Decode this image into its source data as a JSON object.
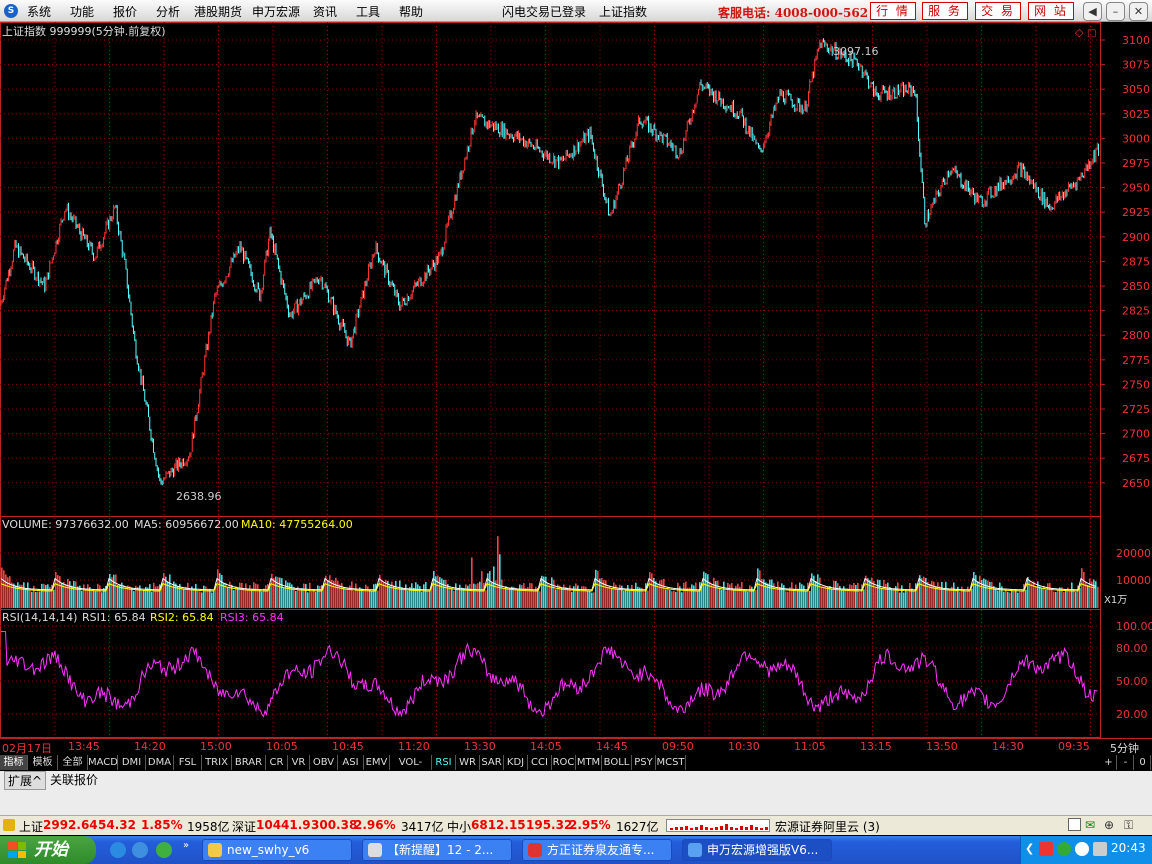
{
  "menu": {
    "items": [
      "系统",
      "功能",
      "报价",
      "分析",
      "港股期货",
      "申万宏源",
      "资讯",
      "工具",
      "帮助"
    ],
    "center": [
      "闪电交易已登录",
      "上证指数"
    ],
    "hotline": "客服电话: 4008-000-562",
    "buttons": [
      "行 情",
      "服 务",
      "交 易",
      "网 站"
    ]
  },
  "chart": {
    "title": "上证指数 999999(5分钟.前复权)",
    "high_label": "3097.16",
    "low_label": "2638.96",
    "price_ticks": [
      "3100",
      "3075",
      "3050",
      "3025",
      "3000",
      "2975",
      "2950",
      "2925",
      "2900",
      "2875",
      "2850",
      "2825",
      "2800",
      "2775",
      "2750",
      "2725",
      "2700",
      "2675",
      "2650"
    ],
    "volume": {
      "label": "VOLUME: 97376632.00",
      "ma5": "MA5: 60956672.00",
      "ma10": "MA10: 47755264.00",
      "ticks": [
        "20000",
        "10000"
      ],
      "unit": "X1万"
    },
    "rsi": {
      "label": "RSI(14,14,14)",
      "rsi1": "RSI1: 65.84",
      "rsi2": "RSI2: 65.84",
      "rsi3": "RSI3: 65.84",
      "ticks": [
        "100.00",
        "80.00",
        "50.00",
        "20.00"
      ]
    },
    "time_labels": [
      "02月17日",
      "13:45",
      "14:20",
      "15:00",
      "10:05",
      "10:45",
      "11:20",
      "13:30",
      "14:05",
      "14:45",
      "09:50",
      "10:30",
      "11:05",
      "13:15",
      "13:50",
      "14:30",
      "09:35"
    ],
    "period": "5分钟"
  },
  "tabs": [
    "指标",
    "模板",
    "全部",
    "MACD",
    "DMI",
    "DMA",
    "FSL",
    "TRIX",
    "BRAR",
    "CR",
    "VR",
    "OBV",
    "ASI",
    "EMV",
    "VOL-TDX",
    "RSI",
    "WR",
    "SAR",
    "KDJ",
    "CCI",
    "ROC",
    "MTM",
    "BOLL",
    "PSY",
    "MCST"
  ],
  "tab_right": [
    "+",
    "-",
    "0"
  ],
  "info_tabs": [
    "扩展^",
    "关联报价"
  ],
  "status": {
    "sh_name": "上证",
    "sh_price": "2992.64",
    "sh_chg": "54.32",
    "sh_pct": "1.85%",
    "sh_amt": "1958亿",
    "sz_name": "深证",
    "sz_price": "10441.9",
    "sz_chg": "300.38",
    "sz_pct": "2.96%",
    "sz_amt": "3417亿",
    "zx_name": "中小",
    "zx_price": "6812.15",
    "zx_chg": "195.32",
    "zx_pct": "2.95%",
    "zx_amt": "1627亿",
    "broker": "宏源证券阿里云 (3)"
  },
  "taskbar": {
    "start": "开始",
    "tasks": [
      "new_swhy_v6",
      "【新提醒】12 - 2...",
      "方正证券泉友通专...",
      "申万宏源增强版V6..."
    ],
    "clock": "20:43"
  },
  "colors": {
    "up": "#ff3333",
    "down": "#54ffff",
    "rsi": "#ff33ff",
    "grid": "#8b0000",
    "ma10": "#ffff00"
  }
}
